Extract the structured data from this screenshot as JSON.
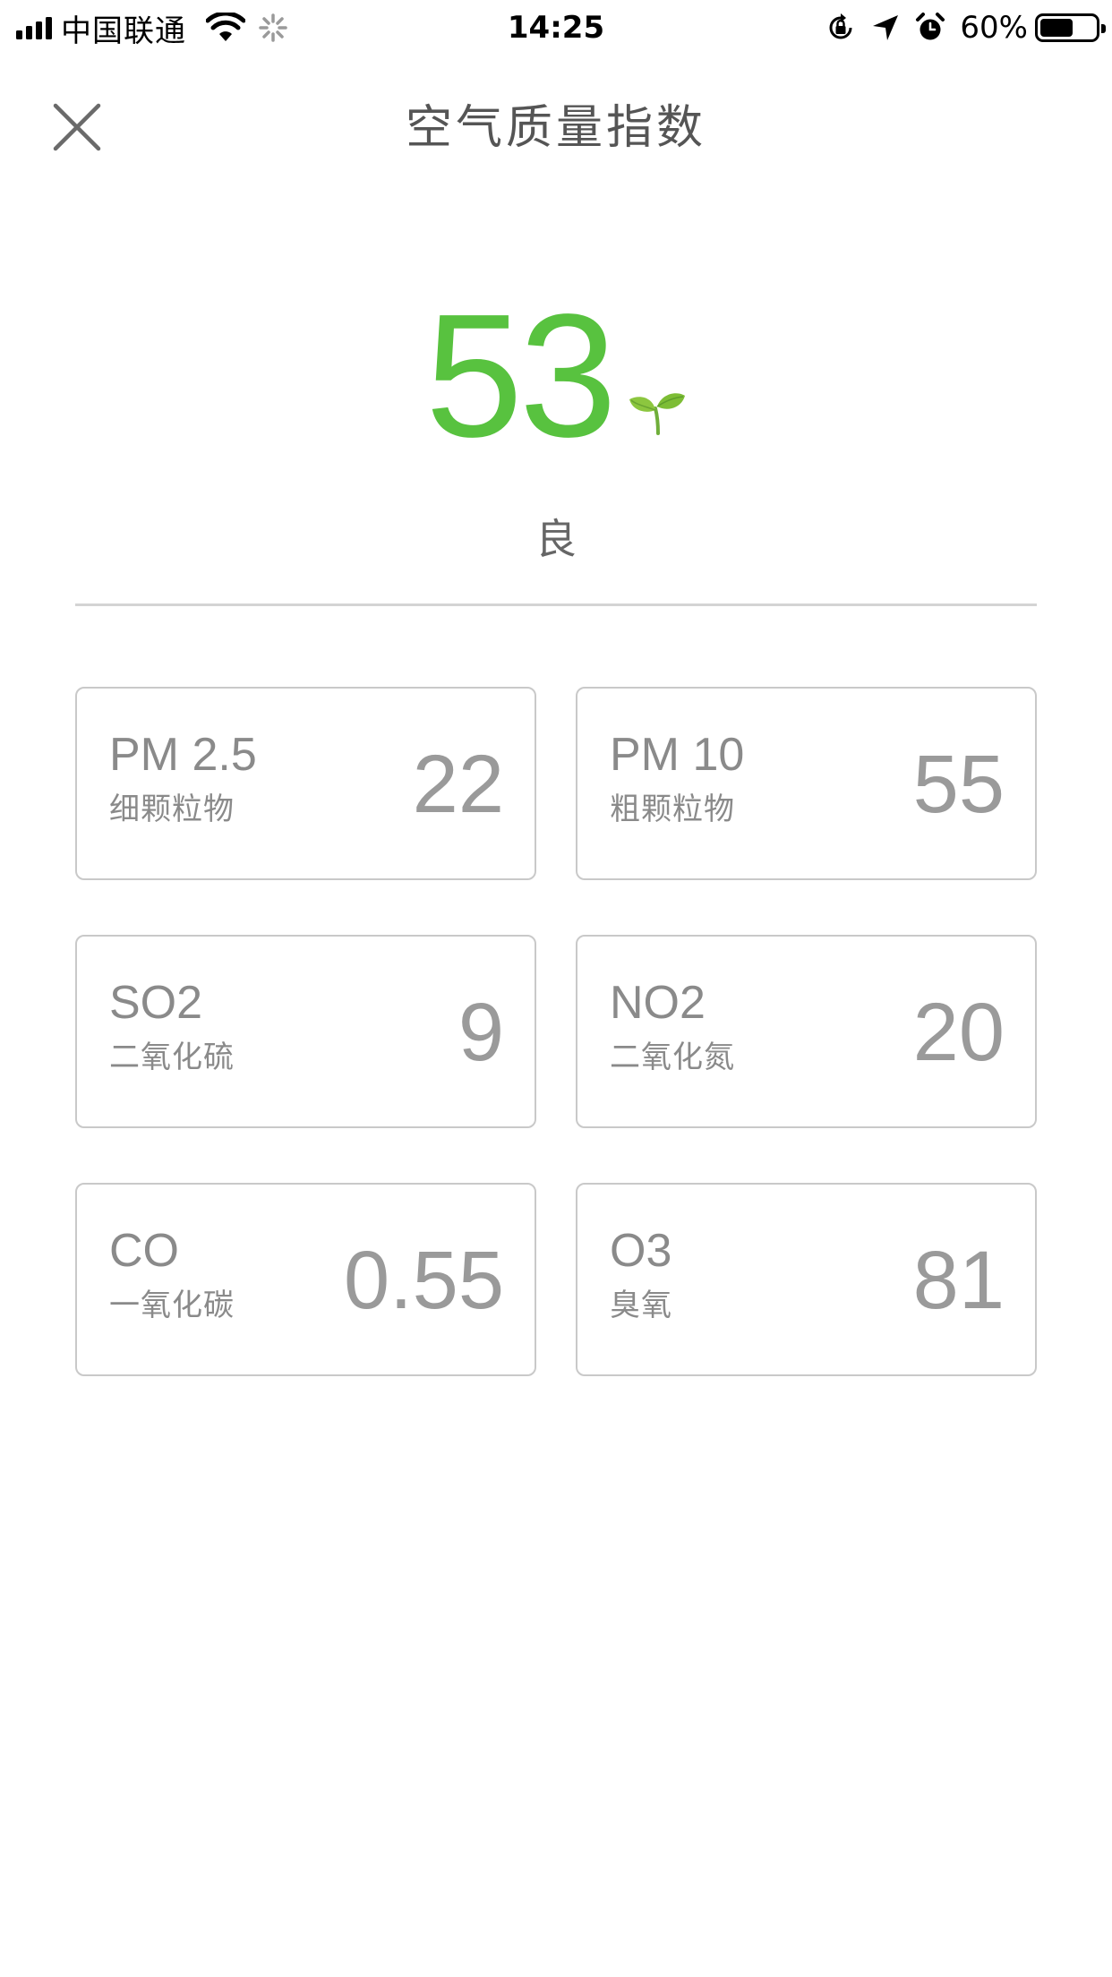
{
  "status_bar": {
    "carrier": "中国联通",
    "time": "14:25",
    "battery_percent": "60%",
    "battery_level": 0.6,
    "icons": [
      "signal-icon",
      "wifi-icon",
      "activity-spinner-icon",
      "orientation-lock-icon",
      "location-arrow-icon",
      "alarm-icon",
      "battery-icon"
    ]
  },
  "header": {
    "title": "空气质量指数",
    "close_icon": "close-icon"
  },
  "aqi": {
    "value": "53",
    "level": "良",
    "icon": "sprout-icon",
    "accent_color": "#58c23f"
  },
  "pollutants": [
    {
      "name": "PM 2.5",
      "sub": "细颗粒物",
      "value": "22"
    },
    {
      "name": "PM 10",
      "sub": "粗颗粒物",
      "value": "55"
    },
    {
      "name": "SO2",
      "sub": "二氧化硫",
      "value": "9"
    },
    {
      "name": "NO2",
      "sub": "二氧化氮",
      "value": "20"
    },
    {
      "name": "CO",
      "sub": "一氧化碳",
      "value": "0.55"
    },
    {
      "name": "O3",
      "sub": "臭氧",
      "value": "81"
    }
  ]
}
